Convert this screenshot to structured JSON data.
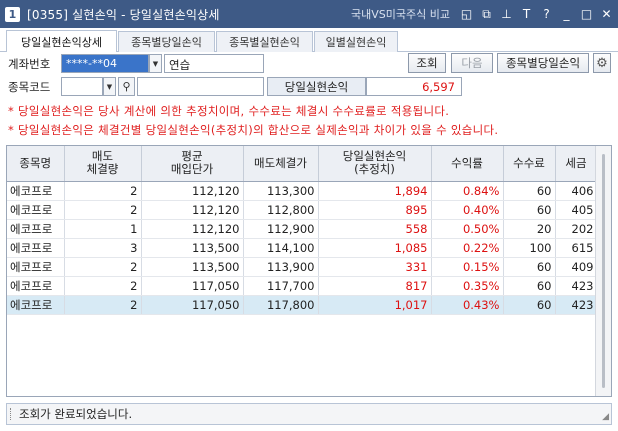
{
  "window": {
    "number": "1",
    "title": "[0355] 실현손익 - 당일실현손익상세",
    "link": "국내VS미국주식 비교",
    "icons": [
      "window-icon",
      "copy-icon",
      "pin-icon",
      "font-icon",
      "help-icon",
      "minimize-icon",
      "maximize-icon",
      "close-icon"
    ],
    "icon_glyphs": [
      "◱",
      "⧉",
      "⊥",
      "T",
      "?",
      "_",
      "□",
      "✕"
    ]
  },
  "tabs": [
    "당일실현손익상세",
    "종목별당일손익",
    "종목별실현손익",
    "일별실현손익"
  ],
  "form": {
    "account_label": "계좌번호",
    "account_value": "****-**04",
    "account_name": "연습",
    "search_button": "조회",
    "next_button": "다음",
    "by_stock_button": "종목별당일손익",
    "code_label": "종목코드",
    "code_value": "",
    "name_value": "",
    "pl_label": "당일실현손익",
    "pl_value": "6,597"
  },
  "notices": [
    "* 당일실현손익은 당사 계산에 의한 추정치이며, 수수료는 체결시 수수료률로 적용됩니다.",
    "* 당일실현손익은 체결건별 당일실현손익(추정치)의 합산으로 실제손익과 차이가 있을 수 있습니다."
  ],
  "table": {
    "headers": [
      [
        "종목명"
      ],
      [
        "매도",
        "체결량"
      ],
      [
        "평균",
        "매입단가"
      ],
      [
        "매도체결가"
      ],
      [
        "당일실현손익",
        "(추정치)"
      ],
      [
        "수익률"
      ],
      [
        "수수료"
      ],
      [
        "세금"
      ]
    ],
    "rows": [
      [
        "에코프로",
        "2",
        "112,120",
        "113,300",
        "1,894",
        "0.84%",
        "60",
        "406"
      ],
      [
        "에코프로",
        "2",
        "112,120",
        "112,800",
        "895",
        "0.40%",
        "60",
        "405"
      ],
      [
        "에코프로",
        "1",
        "112,120",
        "112,900",
        "558",
        "0.50%",
        "20",
        "202"
      ],
      [
        "에코프로",
        "3",
        "113,500",
        "114,100",
        "1,085",
        "0.22%",
        "100",
        "615"
      ],
      [
        "에코프로",
        "2",
        "113,500",
        "113,900",
        "331",
        "0.15%",
        "60",
        "409"
      ],
      [
        "에코프로",
        "2",
        "117,050",
        "117,700",
        "817",
        "0.35%",
        "60",
        "423"
      ],
      [
        "에코프로",
        "2",
        "117,050",
        "117,800",
        "1,017",
        "0.43%",
        "60",
        "423"
      ]
    ]
  },
  "status": "조회가 완료되었습니다.",
  "colors": {
    "titlebar": "#3e5a86",
    "profit": "#dd1111",
    "selected_row": "#d7eaf5",
    "account_highlight": "#3a74c9"
  }
}
